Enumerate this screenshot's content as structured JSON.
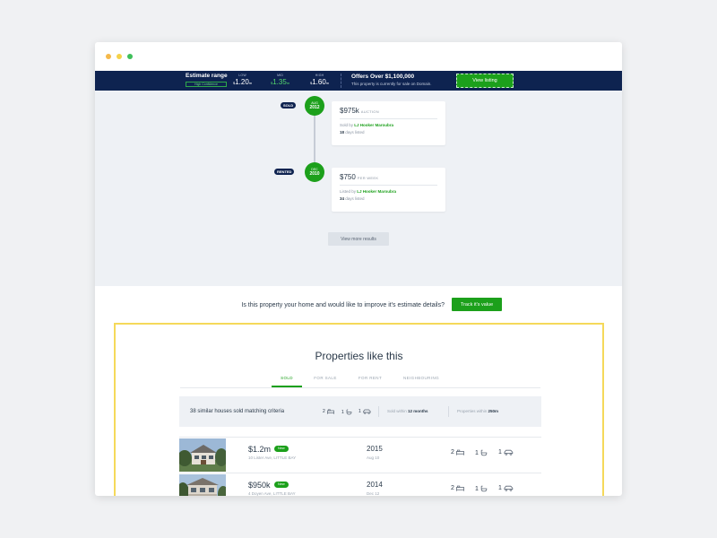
{
  "estimate": {
    "title": "Estimate range",
    "badge": "High Confidence",
    "low": {
      "label": "LOW",
      "cur": "$",
      "value": "1.20",
      "unit": "m"
    },
    "mid": {
      "label": "MID",
      "cur": "$",
      "value": "1.35",
      "unit": "m"
    },
    "high": {
      "label": "HIGH",
      "cur": "$",
      "value": "1.60",
      "unit": "m"
    }
  },
  "offer": {
    "title": "Offers Over $1,100,000",
    "subtitle": "This property is currently for sale on Domain.",
    "button": "View listing"
  },
  "timeline": [
    {
      "tag": "SOLD",
      "month": "AUG",
      "year": "2012",
      "price": "$975k",
      "price_suffix": "AUCTION",
      "by_prefix": "Sold by",
      "agent": "LJ Hooker Maroubra",
      "days": "18",
      "days_suffix": "days listed"
    },
    {
      "tag": "RENTED",
      "month": "DEC",
      "year": "2010",
      "price": "$750",
      "price_suffix": "PER WEEK",
      "by_prefix": "Listed by",
      "agent": "LJ Hooker Maroubra",
      "days": "34",
      "days_suffix": "days listed"
    }
  ],
  "more_button": "View more results",
  "cta": {
    "question": "Is this property your home and would like to improve it's estimate details?",
    "button": "Track it's value"
  },
  "similar": {
    "title": "Properties like this",
    "tabs": [
      "SOLD",
      "FOR SALE",
      "FOR RENT",
      "NEIGHBOURING"
    ],
    "summary": {
      "text": "38 similar houses sold matching criteria",
      "beds": "2",
      "baths": "1",
      "cars": "1",
      "sold_within_label": "Sold within",
      "sold_within_value": "12 months",
      "props_within_label": "Properties within",
      "props_within_value": "250m"
    },
    "rows": [
      {
        "price": "$1.2m",
        "badge": "New",
        "address": "10 Lister Ave, LITTLE BAY",
        "year": "2015",
        "date": "Aug 10",
        "beds": "2",
        "baths": "1",
        "cars": "1"
      },
      {
        "price": "$950k",
        "badge": "New",
        "address": "4 Doyen Ave, LITTLE BAY",
        "year": "2014",
        "date": "Dec 12",
        "beds": "2",
        "baths": "1",
        "cars": "1"
      }
    ]
  },
  "icons": [
    "bed-icon",
    "bath-icon",
    "car-icon"
  ],
  "colors": {
    "navy": "#0e2350",
    "green": "#1ca01b",
    "highlight": "#f5d95a"
  }
}
